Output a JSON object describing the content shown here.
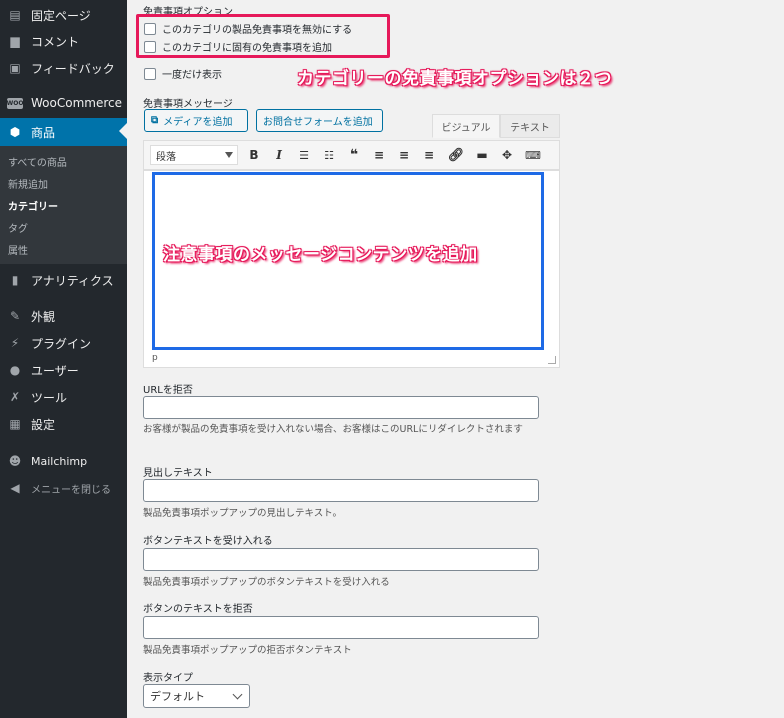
{
  "sidebar": {
    "items": [
      {
        "label": "固定ページ",
        "icon": "page-icon",
        "glyph": "▤"
      },
      {
        "label": "コメント",
        "icon": "comment-icon",
        "glyph": "▆"
      },
      {
        "label": "フィードバック",
        "icon": "feedback-icon",
        "glyph": "▣"
      },
      {
        "label": "WooCommerce",
        "icon": "woocommerce-icon",
        "glyph": "WOO"
      },
      {
        "label": "商品",
        "icon": "product-icon",
        "glyph": "⬢"
      },
      {
        "label": "アナリティクス",
        "icon": "analytics-icon",
        "glyph": "▮"
      },
      {
        "label": "外観",
        "icon": "appearance-icon",
        "glyph": "✎"
      },
      {
        "label": "プラグイン",
        "icon": "plugin-icon",
        "glyph": "⚡"
      },
      {
        "label": "ユーザー",
        "icon": "user-icon",
        "glyph": "●"
      },
      {
        "label": "ツール",
        "icon": "tool-icon",
        "glyph": "✗"
      },
      {
        "label": "設定",
        "icon": "settings-icon",
        "glyph": "▦"
      },
      {
        "label": "Mailchimp",
        "icon": "mailchimp-icon",
        "glyph": "☻"
      },
      {
        "label": "メニューを閉じる",
        "icon": "collapse-icon",
        "glyph": "◀"
      }
    ],
    "subitems": [
      "すべての商品",
      "新規追加",
      "カテゴリー",
      "タグ",
      "属性"
    ]
  },
  "disclaimer": {
    "options_label": "免責事項オプション",
    "opt1": "このカテゴリの製品免責事項を無効にする",
    "opt2": "このカテゴリに固有の免責事項を追加",
    "opt3": "一度だけ表示",
    "message_label": "免責事項メッセージ",
    "media_button": "メディアを追加",
    "contact_button": "お問合せフォームを追加",
    "tab_visual": "ビジュアル",
    "tab_text": "テキスト",
    "format_select": "段落",
    "path": "p"
  },
  "annotations": {
    "options_note": "カテゴリーの免責事項オプションは２つ",
    "editor_note": "注意事項のメッセージコンテンツを追加"
  },
  "fields": {
    "url_label": "URLを拒否",
    "url_help": "お客様が製品の免責事項を受け入れない場合、お客様はこのURLにリダイレクトされます",
    "heading_label": "見出しテキスト",
    "heading_help": "製品免責事項ポップアップの見出しテキスト。",
    "accept_label": "ボタンテキストを受け入れる",
    "accept_help": "製品免責事項ポップアップのボタンテキストを受け入れる",
    "reject_label": "ボタンのテキストを拒否",
    "reject_help": "製品免責事項ポップアップの拒否ボタンテキスト",
    "display_label": "表示タイプ",
    "display_value": "デフォルト"
  },
  "colors": {
    "highlight_pink": "#e6195a",
    "highlight_blue": "#1e6ae6",
    "admin_blue": "#0073aa"
  }
}
